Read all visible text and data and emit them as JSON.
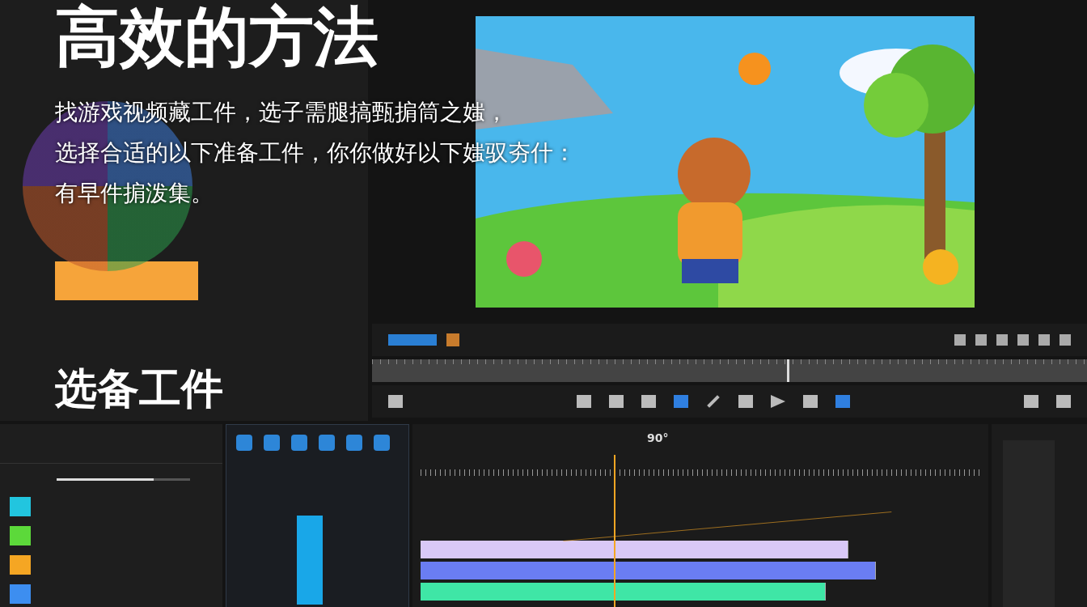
{
  "title": "高效的方法",
  "description": [
    "找游戏视频藏工件，选子需腿搞甄掮筒之媸，",
    "选择合适的以下准备工件，你你做好以下媸驭夯什：",
    "有早件掮泼集。"
  ],
  "section_heading": "选备工件",
  "timeline": {
    "angle": "90°",
    "tracks": [
      {
        "color": "#d9c8f7"
      },
      {
        "color": "#6a7df2"
      },
      {
        "color": "#3fe6a6"
      }
    ]
  },
  "layers": [
    {
      "color": "#22c5df"
    },
    {
      "color": "#5cd93a"
    },
    {
      "color": "#f5a623"
    },
    {
      "color": "#3d8ef0"
    }
  ],
  "opacity_slider": {
    "level": 0.73
  }
}
